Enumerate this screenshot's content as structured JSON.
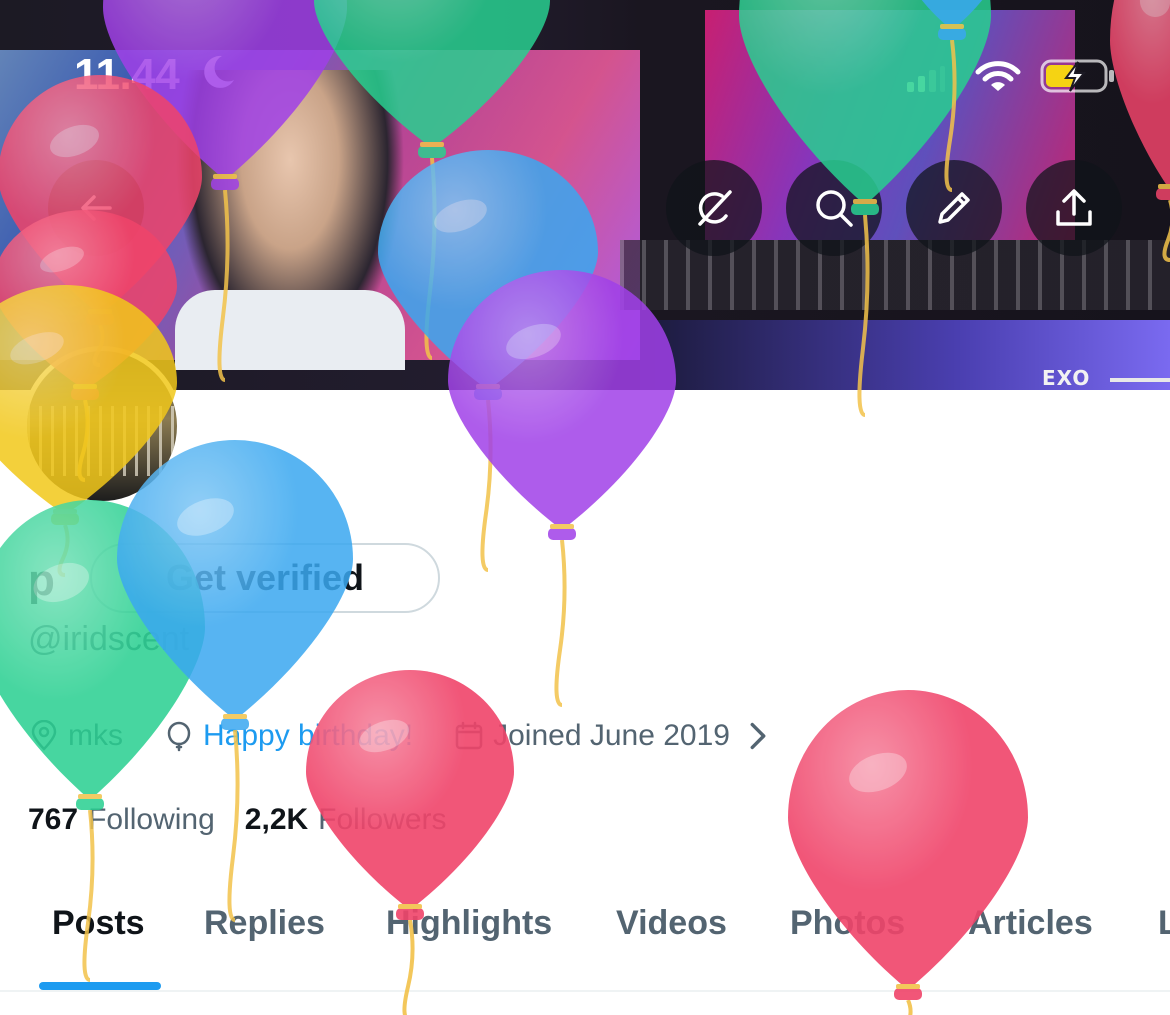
{
  "status_bar": {
    "time": "11.44"
  },
  "banner": {
    "stage_logo": "EXO"
  },
  "profile": {
    "display_name_initial": "p",
    "get_verified_label": "Get verified",
    "handle": "@iridscent",
    "location": "mks",
    "birthday": "Happy birthday!",
    "joined": "Joined June 2019",
    "following_count": "767",
    "following_label": "Following",
    "followers_count": "2,2K",
    "followers_label": "Followers"
  },
  "tabs": [
    {
      "label": "Posts",
      "active": true
    },
    {
      "label": "Replies",
      "active": false
    },
    {
      "label": "Highlights",
      "active": false
    },
    {
      "label": "Videos",
      "active": false
    },
    {
      "label": "Photos",
      "active": false
    },
    {
      "label": "Articles",
      "active": false
    },
    {
      "label": "L",
      "active": false
    }
  ],
  "colors": {
    "accent": "#1d9bf0",
    "text_primary": "#0f1419",
    "text_secondary": "#536471",
    "balloon_red": "#f0446a",
    "balloon_purple": "#a040e8",
    "balloon_green": "#28d090",
    "balloon_blue": "#3aa8f0",
    "balloon_yellow": "#f2c81a"
  },
  "icons": {
    "back": "arrow-left-icon",
    "grok": "grok-icon",
    "search": "search-icon",
    "edit": "pencil-icon",
    "share": "share-icon",
    "location": "location-pin-icon",
    "birthday": "balloon-icon",
    "calendar": "calendar-icon"
  }
}
